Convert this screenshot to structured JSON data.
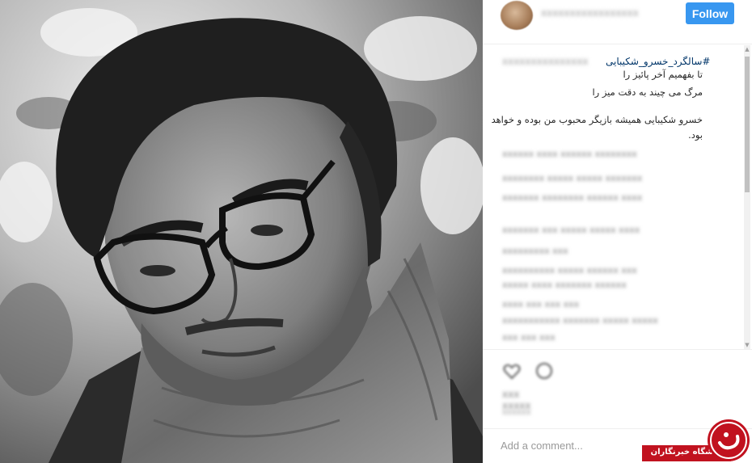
{
  "post": {
    "header": {
      "follow_label": "Follow"
    },
    "caption": {
      "hashtag": "#سالگرد_خسرو_شکیبایی",
      "lines": [
        "تا بفهمیم آخر پائیز را",
        "مرگ می چیند به دقت میز را",
        "خسرو شکیبایی همیشه بازیگر محبوب من بوده و خواهد",
        "بود."
      ]
    },
    "comment_box": {
      "placeholder": "Add a comment..."
    }
  },
  "watermark": {
    "text": "باشگاه خبرنگاران"
  },
  "colors": {
    "follow_button": "#3897f0",
    "hashtag_link": "#003569",
    "watermark_red": "#c1121f"
  }
}
